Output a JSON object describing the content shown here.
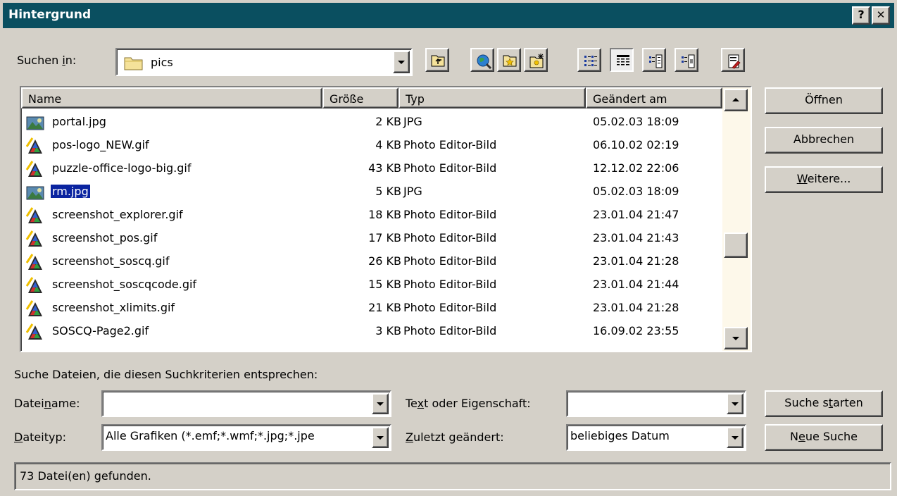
{
  "window": {
    "title": "Hintergrund",
    "help_label": "?",
    "close_label": "✕"
  },
  "look_in": {
    "label_prefix": "Suchen ",
    "label_accel": "i",
    "label_suffix": "n:",
    "value": "pics"
  },
  "toolbar": {
    "buttons": [
      {
        "name": "up-folder-button",
        "icon": "up-folder-icon"
      },
      {
        "name": "search-web-button",
        "icon": "globe-search-icon"
      },
      {
        "name": "favorites-button",
        "icon": "favorites-folder-icon"
      },
      {
        "name": "new-folder-button",
        "icon": "new-folder-icon"
      },
      {
        "name": "view-list-button",
        "icon": "list-view-icon"
      },
      {
        "name": "view-details-button",
        "icon": "details-view-icon"
      },
      {
        "name": "view-properties-button",
        "icon": "properties-view-icon"
      },
      {
        "name": "view-preview-button",
        "icon": "preview-view-icon"
      },
      {
        "name": "commands-button",
        "icon": "tools-icon"
      }
    ]
  },
  "file_list": {
    "columns": [
      "Name",
      "Größe",
      "Typ",
      "Geändert am"
    ],
    "rows": [
      {
        "name": "portal.jpg",
        "size": "2 KB",
        "type": "JPG",
        "modified": "05.02.03 18:09",
        "icon": "jpg-file-icon",
        "selected": false
      },
      {
        "name": "pos-logo_NEW.gif",
        "size": "4 KB",
        "type": "Photo Editor-Bild",
        "modified": "06.10.02 02:19",
        "icon": "photo-editor-icon",
        "selected": false
      },
      {
        "name": "puzzle-office-logo-big.gif",
        "size": "43 KB",
        "type": "Photo Editor-Bild",
        "modified": "12.12.02 22:06",
        "icon": "photo-editor-icon",
        "selected": false
      },
      {
        "name": "rm.jpg",
        "size": "5 KB",
        "type": "JPG",
        "modified": "05.02.03 18:09",
        "icon": "jpg-file-icon",
        "selected": true
      },
      {
        "name": "screenshot_explorer.gif",
        "size": "18 KB",
        "type": "Photo Editor-Bild",
        "modified": "23.01.04 21:47",
        "icon": "photo-editor-icon",
        "selected": false
      },
      {
        "name": "screenshot_pos.gif",
        "size": "17 KB",
        "type": "Photo Editor-Bild",
        "modified": "23.01.04 21:43",
        "icon": "photo-editor-icon",
        "selected": false
      },
      {
        "name": "screenshot_soscq.gif",
        "size": "26 KB",
        "type": "Photo Editor-Bild",
        "modified": "23.01.04 21:28",
        "icon": "photo-editor-icon",
        "selected": false
      },
      {
        "name": "screenshot_soscqcode.gif",
        "size": "15 KB",
        "type": "Photo Editor-Bild",
        "modified": "23.01.04 21:44",
        "icon": "photo-editor-icon",
        "selected": false
      },
      {
        "name": "screenshot_xlimits.gif",
        "size": "21 KB",
        "type": "Photo Editor-Bild",
        "modified": "23.01.04 21:28",
        "icon": "photo-editor-icon",
        "selected": false
      },
      {
        "name": "SOSCQ-Page2.gif",
        "size": "3 KB",
        "type": "Photo Editor-Bild",
        "modified": "16.09.02 23:55",
        "icon": "photo-editor-icon",
        "selected": false
      }
    ]
  },
  "buttons": {
    "open": "Öffnen",
    "cancel": "Abbrechen",
    "more_accel": "W",
    "more_rest": "eitere...",
    "search_start_prefix": "Suche s",
    "search_start_accel": "t",
    "search_start_suffix": "arten",
    "new_search_prefix": "N",
    "new_search_accel": "e",
    "new_search_suffix": "ue Suche"
  },
  "search": {
    "heading": "Suche Dateien, die diesen Suchkriterien entsprechen:",
    "filename_label_prefix": "Datei",
    "filename_label_accel": "n",
    "filename_label_suffix": "ame:",
    "filename_value": "",
    "filetype_label_accel": "D",
    "filetype_label_suffix": "ateityp:",
    "filetype_value": "Alle Grafiken (*.emf;*.wmf;*.jpg;*.jpe",
    "text_label_prefix": "Te",
    "text_label_accel": "x",
    "text_label_suffix": "t oder Eigenschaft:",
    "text_value": "",
    "modified_label_accel": "Z",
    "modified_label_suffix": "uletzt geändert:",
    "modified_value": "beliebiges Datum"
  },
  "status": {
    "text": "73 Datei(en) gefunden."
  },
  "colors": {
    "title_bar": "#0a4f60",
    "selection": "#0a24a0",
    "face": "#d4d0c8"
  }
}
